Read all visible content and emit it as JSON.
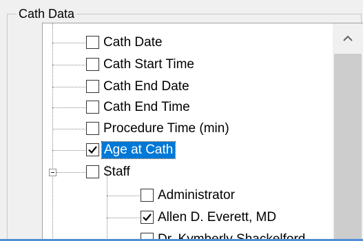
{
  "group": {
    "title": "Cath Data"
  },
  "tree": {
    "items": [
      {
        "label": "Cath Date",
        "checked": false,
        "selected": false,
        "level": 1
      },
      {
        "label": "Cath Start Time",
        "checked": false,
        "selected": false,
        "level": 1
      },
      {
        "label": "Cath End Date",
        "checked": false,
        "selected": false,
        "level": 1
      },
      {
        "label": "Cath End Time",
        "checked": false,
        "selected": false,
        "level": 1
      },
      {
        "label": "Procedure Time (min)",
        "checked": false,
        "selected": false,
        "level": 1
      },
      {
        "label": "Age at Cath",
        "checked": true,
        "selected": true,
        "level": 1
      },
      {
        "label": "Staff",
        "checked": false,
        "selected": false,
        "level": 1,
        "expanded": true
      },
      {
        "label": "Administrator",
        "checked": false,
        "selected": false,
        "level": 2
      },
      {
        "label": "Allen D. Everett, MD",
        "checked": true,
        "selected": false,
        "level": 2
      },
      {
        "label": "Dr. Kymberly Shackelford",
        "checked": false,
        "selected": false,
        "level": 2
      }
    ]
  },
  "icons": {
    "scroll_up": "chevron-up-icon",
    "checkmark": "checkmark-icon",
    "expander": "collapse-minus-icon"
  },
  "colors": {
    "selection": "#0078d7",
    "accent_line": "#4f90d6",
    "tree_background": "#ffffff",
    "scroll_thumb": "#cdcdcd"
  }
}
